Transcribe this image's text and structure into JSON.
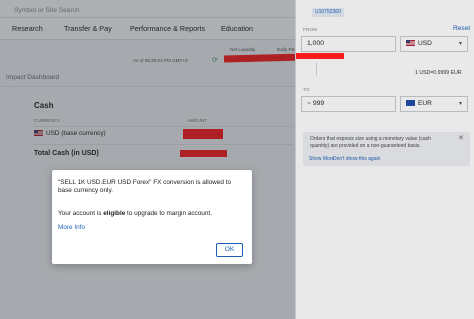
{
  "header": {
    "search_placeholder": "Symbol or Site Search",
    "nav": [
      "Research",
      "Transfer & Pay",
      "Performance & Reports",
      "Education"
    ]
  },
  "dashboard": {
    "as_of": "As of 08:20:04 PM GMT+3",
    "net_liquidity_label": "Net Liquidity",
    "daily_pl_label": "Daily P&L",
    "impact_title": "Impact Dashboard",
    "cash_title": "Cash",
    "currency_col": "CURRENCY",
    "amount_col": "AMOUNT",
    "usd_row": "USD (base currency)",
    "total_row": "Total Cash (in USD)"
  },
  "modal": {
    "message": "\"SELL 1K USD.EUR USD Forex\" FX conversion is allowed to base currency only.",
    "eligible_prefix": "Your account is ",
    "eligible_bold": "eligible",
    "eligible_suffix": " to upgrade to margin account.",
    "more_info": "More Info",
    "ok_label": "OK"
  },
  "fx_panel": {
    "account_id": "U10752360",
    "reset_label": "Reset",
    "from_label": "FROM",
    "from_amount": "1,000",
    "from_currency": "USD",
    "rate_text": "1 USD=0.9999 EUR",
    "to_label": "TO",
    "to_amount": "~ 999",
    "to_currency": "EUR",
    "notice_text": "Orders that express size using a monetary value (cash quantity) are provided on a non-guaranteed basis.",
    "show_more": "Show More",
    "dont_show": "Don't show this again"
  },
  "colors": {
    "accent": "#1a5fb4",
    "redaction": "#ff1b1b",
    "refresh": "#2e9e5b"
  }
}
